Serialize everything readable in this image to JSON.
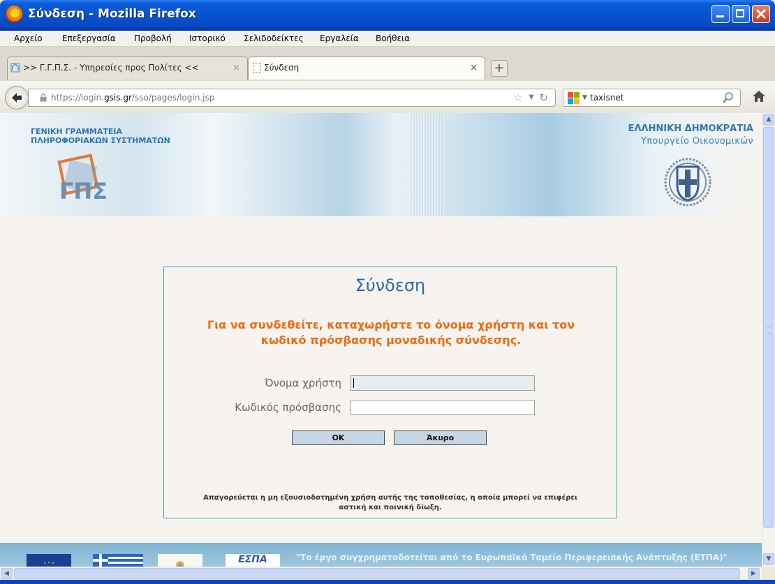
{
  "window": {
    "title": "Σύνδεση - Mozilla Firefox"
  },
  "menu": {
    "items": [
      "Αρχείο",
      "Επεξεργασία",
      "Προβολή",
      "Ιστορικό",
      "Σελιδοδείκτες",
      "Εργαλεία",
      "Βοήθεια"
    ]
  },
  "tabs": [
    {
      "label": ">> Γ.Γ.Π.Σ. - Υπηρεσίες προς Πολίτες <<",
      "active": false
    },
    {
      "label": "Σύνδεση",
      "active": true
    }
  ],
  "nav": {
    "url_prefix": "https://login.",
    "url_domain": "gsis.gr",
    "url_path": "/sso/pages/login.jsp",
    "search_value": "taxisnet"
  },
  "header": {
    "org_line1": "ΓΕΝΙΚΗ ΓΡΑΜΜΑΤΕΙΑ",
    "org_line2": "ΠΛΗΡΟΦΟΡΙΑΚΩΝ ΣΥΣΤΗΜΑΤΩΝ",
    "gsis_logo_text": "ΓΠΣ",
    "ministry_line1": "ΕΛΛΗΝΙΚΗ ΔΗΜΟΚΡΑΤΙΑ",
    "ministry_line2": "Υπουργείο Οικονομικών"
  },
  "login": {
    "title": "Σύνδεση",
    "instructions_line1": "Για να συνδεθείτε, καταχωρήστε το όνομα χρήστη και τον",
    "instructions_line2": "κωδικό πρόσβασης μοναδικής σύνδεσης.",
    "username_label": "Όνομα χρήστη",
    "password_label": "Κωδικός πρόσβασης",
    "username_value": "",
    "password_value": "",
    "ok_label": "OK",
    "cancel_label": "Άκυρο",
    "legal_line1": "Απαγορεύεται η μη εξουσιοδοτημένη χρήση αυτής της τοποθεσίας, η οποία μπορεί να επιφέρει",
    "legal_line2": "αστική και ποινική δίωξη."
  },
  "footer": {
    "text": "\"Το έργο συγχρηματοδοτείται από το Ευρωπαϊκό Ταμείο Περιφερειακής Ανάπτυξης (ΕΤΠΑ)\"",
    "espa_label": "ΕΣΠΑ"
  },
  "colors": {
    "accent_blue": "#2c79b0",
    "instruction_orange": "#ef6a10",
    "box_border": "#44a0c8"
  }
}
